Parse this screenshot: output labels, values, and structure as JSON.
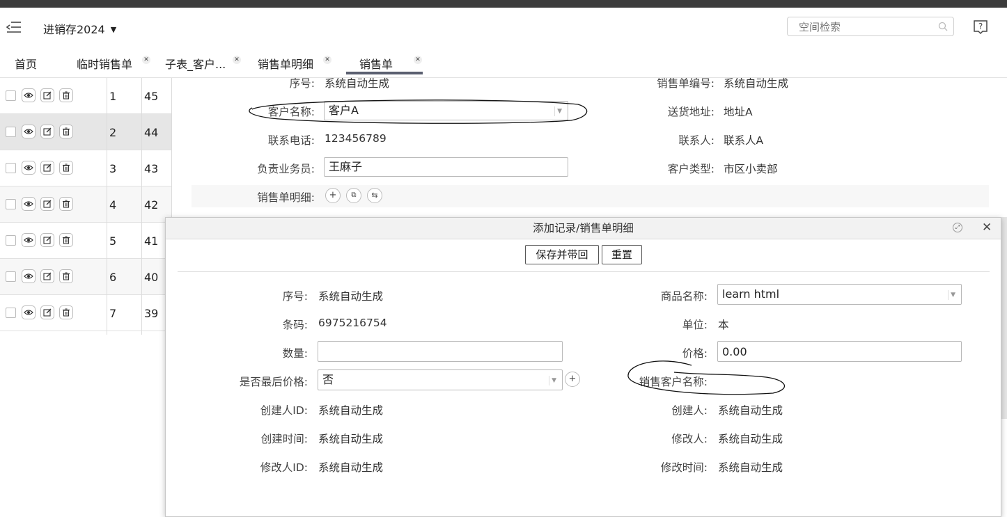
{
  "header": {
    "app_title": "进销存2024",
    "search_placeholder": "空间检索"
  },
  "tabs": [
    {
      "label": "首页"
    },
    {
      "label": "临时销售单"
    },
    {
      "label": "子表_客户..."
    },
    {
      "label": "销售单明细"
    },
    {
      "label": "销售单",
      "active": true
    }
  ],
  "table": {
    "rows": [
      {
        "n": "1",
        "v": "45"
      },
      {
        "n": "2",
        "v": "44",
        "selected": true
      },
      {
        "n": "3",
        "v": "43"
      },
      {
        "n": "4",
        "v": "42"
      },
      {
        "n": "5",
        "v": "41"
      },
      {
        "n": "6",
        "v": "40"
      },
      {
        "n": "7",
        "v": "39"
      }
    ]
  },
  "main_form": {
    "seq_label": "序号:",
    "seq_value": "系统自动生成",
    "order_no_label": "销售单编号:",
    "order_no_value": "系统自动生成",
    "customer_label": "客户名称:",
    "customer_value": "客户A",
    "address_label": "送货地址:",
    "address_value": "地址A",
    "phone_label": "联系电话:",
    "phone_value": "123456789",
    "contact_label": "联系人:",
    "contact_value": "联系人A",
    "salesman_label": "负责业务员:",
    "salesman_value": "王麻子",
    "cust_type_label": "客户类型:",
    "cust_type_value": "市区小卖部",
    "detail_label": "销售单明细:"
  },
  "dialog": {
    "title": "添加记录/销售单明细",
    "save_label": "保存并带回",
    "reset_label": "重置",
    "seq_label": "序号:",
    "seq_value": "系统自动生成",
    "product_label": "商品名称:",
    "product_value": "learn html",
    "barcode_label": "条码:",
    "barcode_value": "6975216754",
    "unit_label": "单位:",
    "unit_value": "本",
    "qty_label": "数量:",
    "qty_value": "",
    "price_label": "价格:",
    "price_value": "0.00",
    "last_price_label": "是否最后价格:",
    "last_price_value": "否",
    "sale_customer_label": "销售客户名称:",
    "creator_id_label": "创建人ID:",
    "creator_id_value": "系统自动生成",
    "creator_label": "创建人:",
    "creator_value": "系统自动生成",
    "create_time_label": "创建时间:",
    "create_time_value": "系统自动生成",
    "modifier_label": "修改人:",
    "modifier_value": "系统自动生成",
    "modifier_id_label": "修改人ID:",
    "modifier_id_value": "系统自动生成",
    "modify_time_label": "修改时间:",
    "modify_time_value": "系统自动生成"
  }
}
